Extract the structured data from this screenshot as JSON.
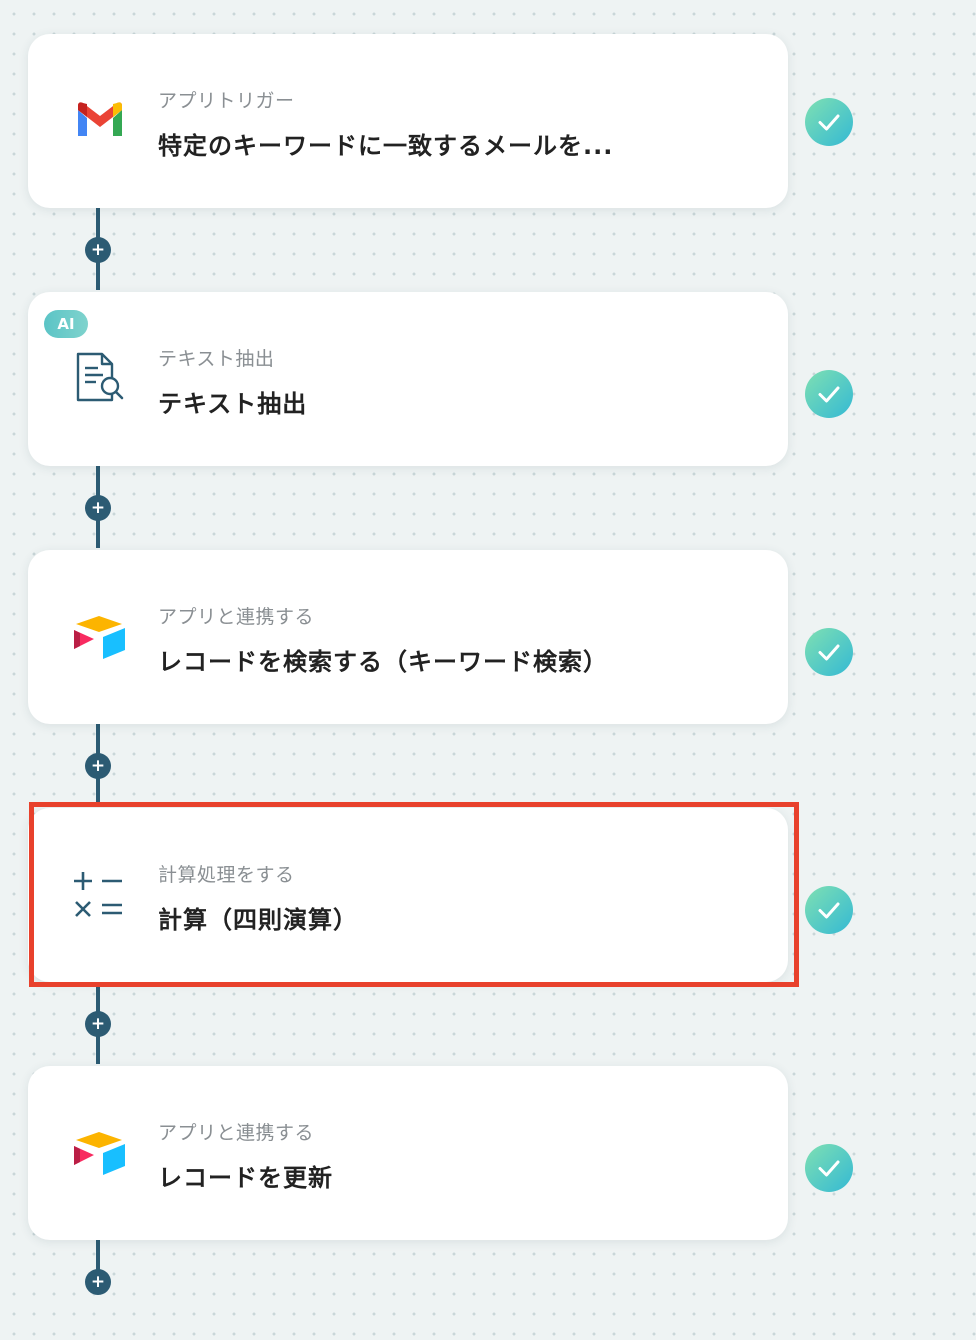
{
  "steps": [
    {
      "icon": "gmail-icon",
      "label": "アプリトリガー",
      "title": "特定のキーワードに一致するメールを...",
      "status": "completed"
    },
    {
      "icon": "text-extract-icon",
      "badge": "AI",
      "label": "テキスト抽出",
      "title": "テキスト抽出",
      "status": "completed"
    },
    {
      "icon": "airtable-icon",
      "label": "アプリと連携する",
      "title": "レコードを検索する（キーワード検索）",
      "status": "completed"
    },
    {
      "icon": "calculator-operators-icon",
      "label": "計算処理をする",
      "title": "計算（四則演算）",
      "status": "completed",
      "highlighted": true
    },
    {
      "icon": "airtable-icon",
      "label": "アプリと連携する",
      "title": "レコードを更新",
      "status": "completed"
    }
  ],
  "add_button_symbol": "+",
  "colors": {
    "connector": "#2c5b73",
    "highlight_border": "#e8412c",
    "check_gradient_start": "#7fe0b2",
    "check_gradient_end": "#34b9d4",
    "ai_badge": "#5bc4c6"
  }
}
